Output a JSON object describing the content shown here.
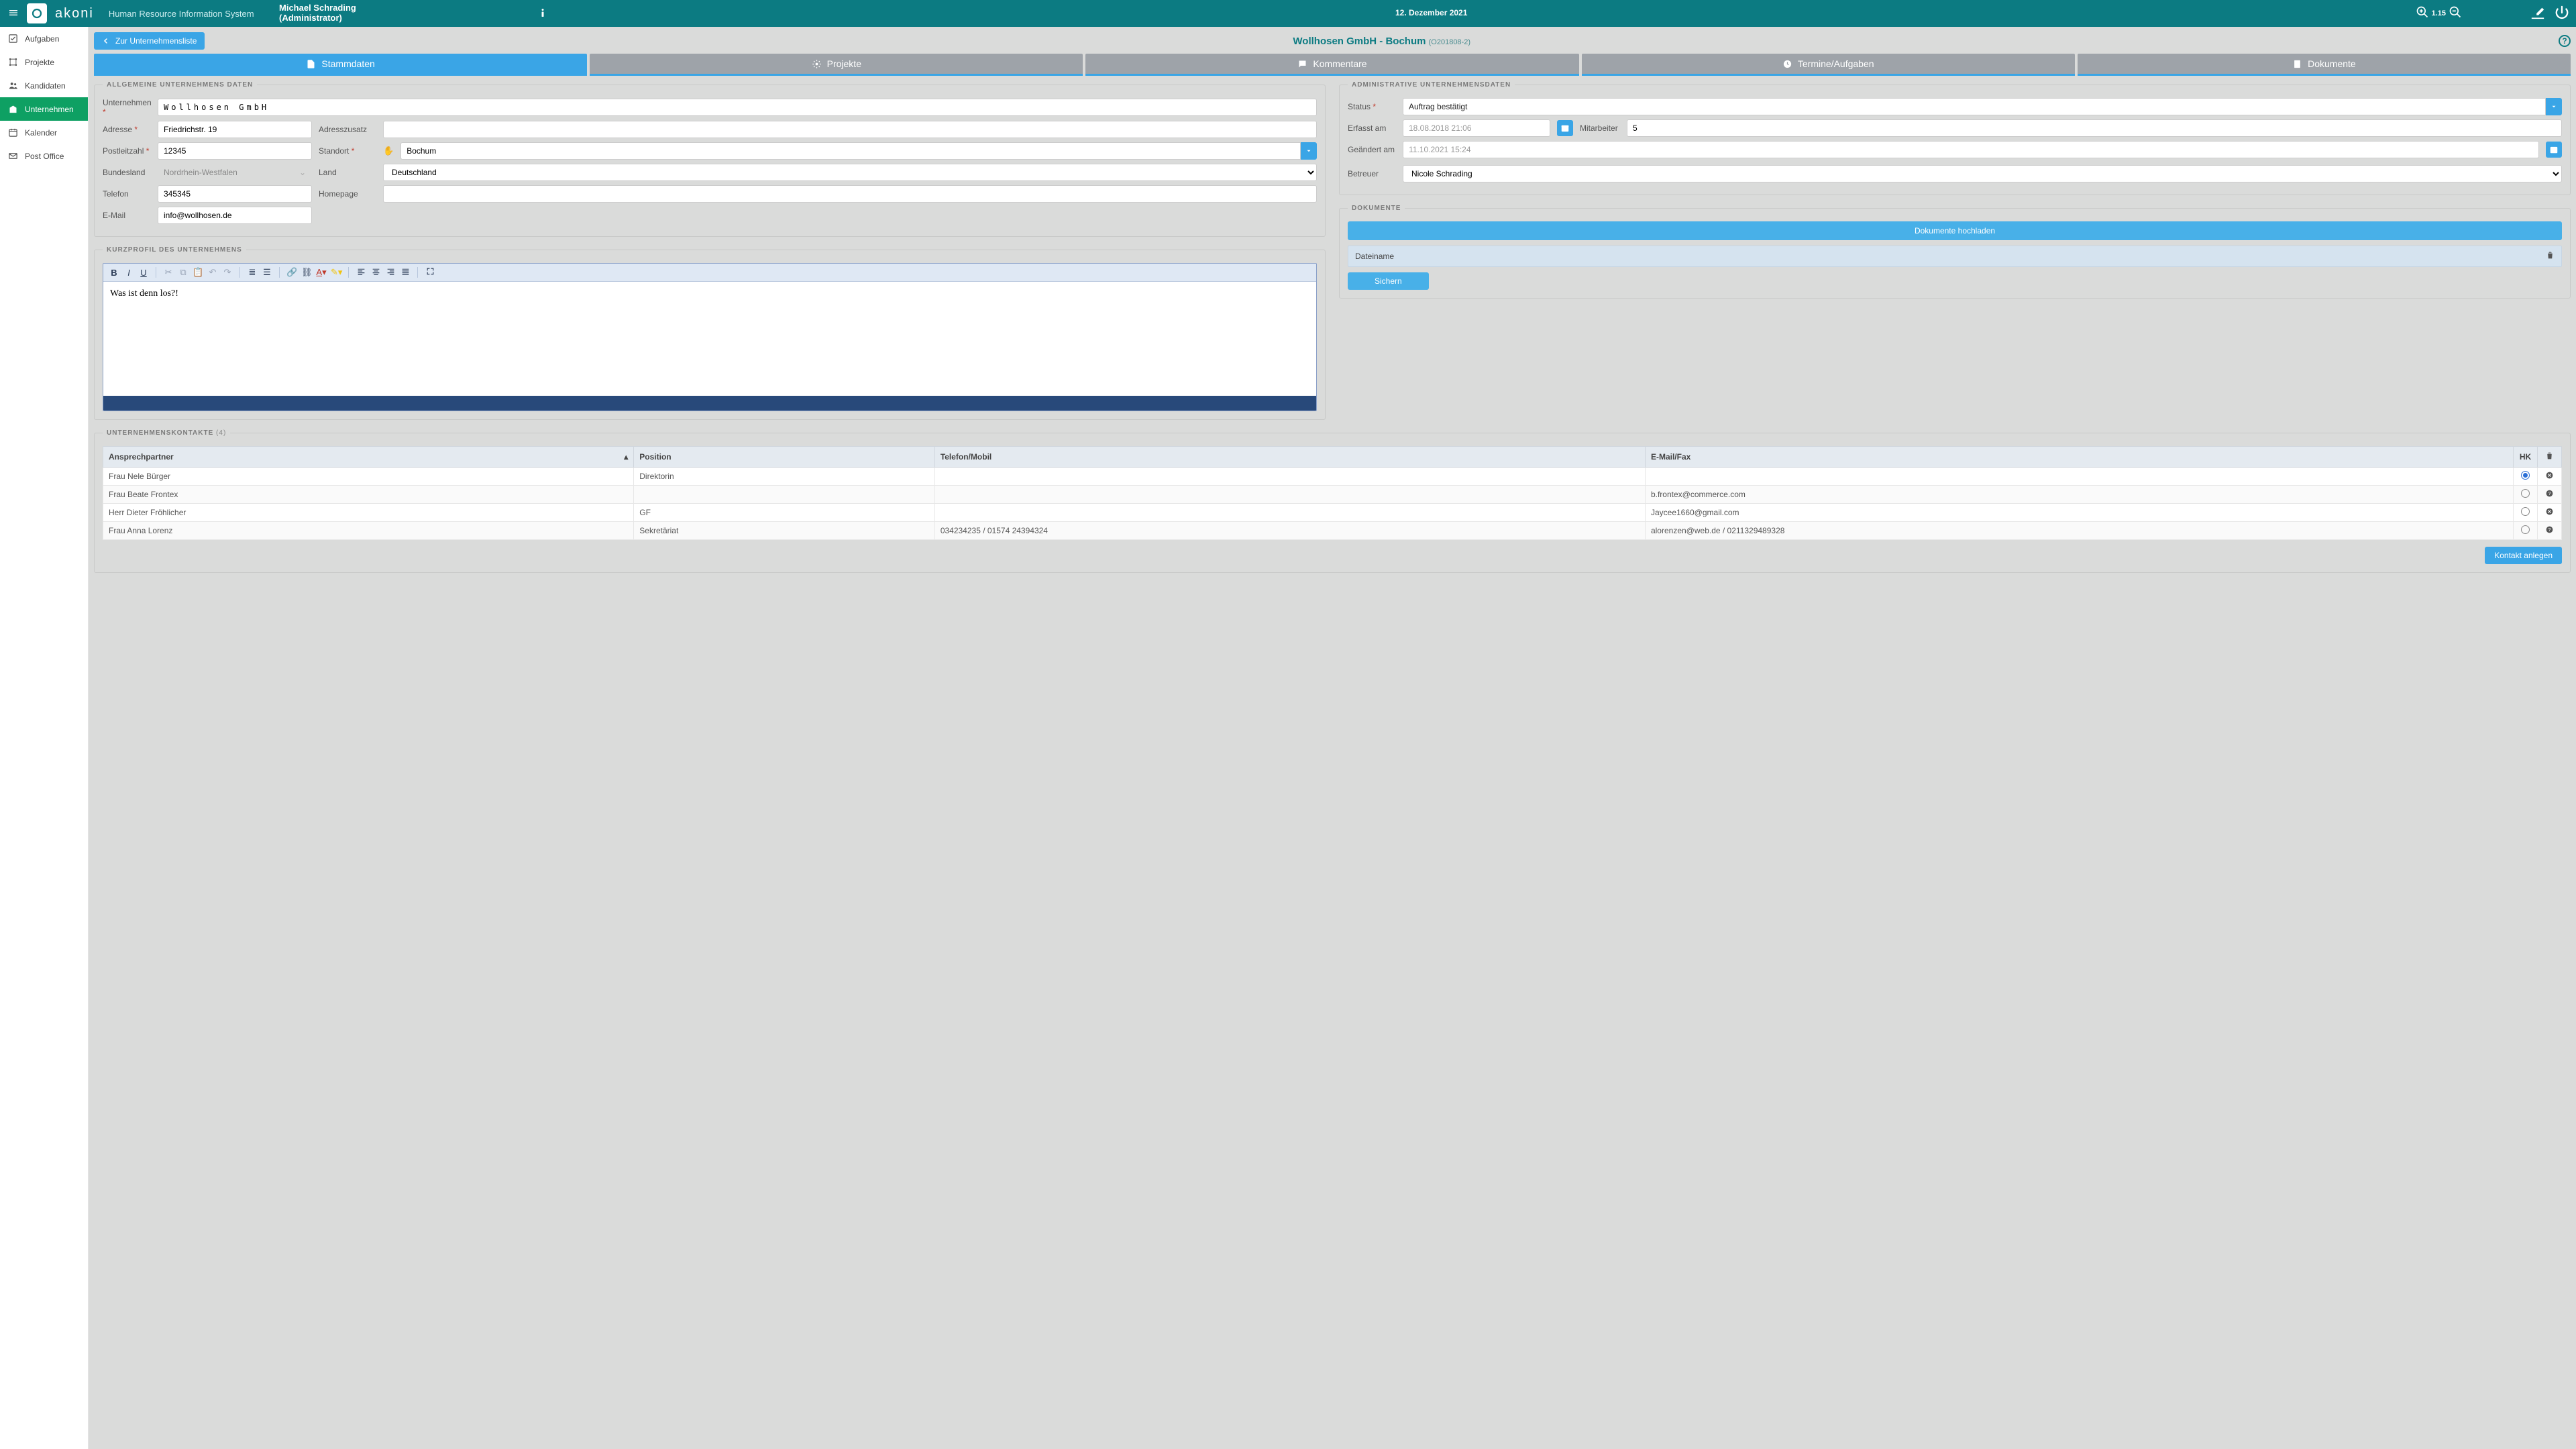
{
  "header": {
    "brand": "akoni",
    "subtitle": "Human Resource Information System",
    "user_name": "Michael Schrading",
    "user_role": "(Administrator)",
    "date": "12. Dezember 2021",
    "zoom": "1.15"
  },
  "sidebar": {
    "items": [
      {
        "label": "Aufgaben"
      },
      {
        "label": "Projekte"
      },
      {
        "label": "Kandidaten"
      },
      {
        "label": "Unternehmen"
      },
      {
        "label": "Kalender"
      },
      {
        "label": "Post Office"
      }
    ]
  },
  "subheader": {
    "back": "Zur Unternehmensliste",
    "title": "Wollhosen GmbH - Bochum",
    "code": "(O201808-2)"
  },
  "tabs": [
    {
      "label": "Stammdaten"
    },
    {
      "label": "Projekte"
    },
    {
      "label": "Kommentare"
    },
    {
      "label": "Termine/Aufgaben"
    },
    {
      "label": "Dokumente"
    }
  ],
  "sections": {
    "general": "ALLGEMEINE UNTERNEHMENS DATEN",
    "admin": "ADMINISTRATIVE UNTERNEHMENSDATEN",
    "profile": "KURZPROFIL DES UNTERNEHMENS",
    "docs": "DOKUMENTE",
    "contacts": "UNTERNEHMENSKONTAKTE",
    "contacts_count": "(4)"
  },
  "labels": {
    "unternehmen": "Unternehmen",
    "adresse": "Adresse",
    "adresszusatz": "Adresszusatz",
    "plz": "Postleitzahl",
    "standort": "Standort",
    "bundesland": "Bundesland",
    "land": "Land",
    "telefon": "Telefon",
    "homepage": "Homepage",
    "email": "E-Mail",
    "status": "Status",
    "erfasst": "Erfasst am",
    "mitarbeiter": "Mitarbeiter",
    "geaendert": "Geändert am",
    "betreuer": "Betreuer",
    "dateiname": "Dateiname",
    "upload": "Dokumente hochladen",
    "sichern": "Sichern",
    "new_contact": "Kontakt anlegen"
  },
  "company": {
    "name": "Wollhosen GmbH",
    "street": "Friedrichstr. 19",
    "addr2": "",
    "zip": "12345",
    "city": "Bochum",
    "state": "Nordrhein-Westfalen",
    "country": "Deutschland",
    "phone": "345345",
    "homepage": "",
    "email": "info@wollhosen.de"
  },
  "admin": {
    "status": "Auftrag bestätigt",
    "created": "18.08.2018 21:06",
    "employees": "5",
    "changed": "11.10.2021 15:24",
    "owner": "Nicole Schrading"
  },
  "profile_text": "Was ist denn los?!",
  "contacts": {
    "headers": {
      "partner": "Ansprechpartner",
      "position": "Position",
      "phone": "Telefon/Mobil",
      "email": "E-Mail/Fax",
      "hk": "HK"
    },
    "rows": [
      {
        "name": "Frau Nele Bürger",
        "position": "Direktorin",
        "phone": "",
        "email": "",
        "hk": true,
        "info": "x"
      },
      {
        "name": "Frau Beate Frontex",
        "position": "",
        "phone": "",
        "email": "b.frontex@commerce.com",
        "hk": false,
        "info": "?"
      },
      {
        "name": "Herr Dieter Fröhlicher",
        "position": "GF",
        "phone": "",
        "email": "Jaycee1660@gmail.com",
        "hk": false,
        "info": "x"
      },
      {
        "name": "Frau Anna Lorenz",
        "position": "Sekretäriat",
        "phone": "034234235 / 01574 24394324",
        "email": "alorenzen@web.de / 0211329489328",
        "hk": false,
        "info": "?"
      }
    ]
  }
}
